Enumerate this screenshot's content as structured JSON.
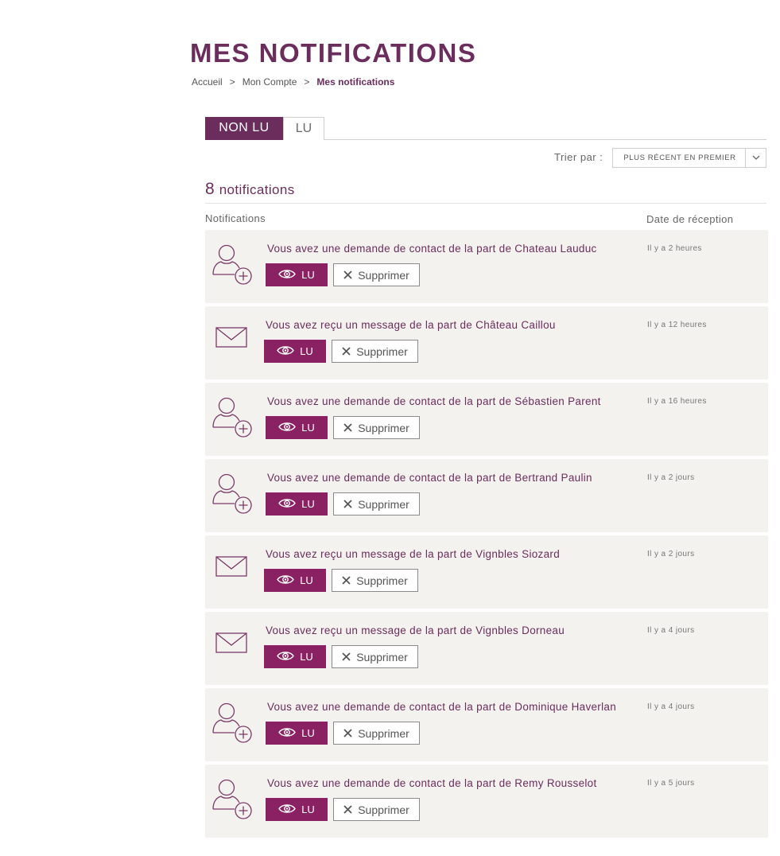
{
  "header": {
    "title": "MES NOTIFICATIONS",
    "breadcrumb": [
      {
        "label": "Accueil"
      },
      {
        "label": "Mon Compte"
      },
      {
        "label": "Mes notifications"
      }
    ],
    "breadcrumb_separator": ">"
  },
  "tabs": [
    {
      "label": "NON LU",
      "active": true
    },
    {
      "label": "LU",
      "active": false
    }
  ],
  "sort": {
    "label": "Trier par :",
    "value": "PLUS RÉCENT EN PREMIER"
  },
  "summary": {
    "count": "8",
    "label": "notifications"
  },
  "columns": {
    "notifications": "Notifications",
    "date": "Date de réception"
  },
  "buttons": {
    "read_label": "LU",
    "delete_label": "Supprimer"
  },
  "colors": {
    "brand": "#6b2d5c",
    "button": "#8a2163",
    "row_bg": "#f4f2ef"
  },
  "notifications": [
    {
      "type": "contact",
      "icon": "user-add-icon",
      "text": "Vous avez une demande de contact de la part de Chateau Lauduc",
      "date": "Il y a 2 heures"
    },
    {
      "type": "message",
      "icon": "envelope-icon",
      "text": "Vous avez reçu un message de la part de Château Caillou",
      "date": "Il y a 12 heures"
    },
    {
      "type": "contact",
      "icon": "user-add-icon",
      "text": "Vous avez une demande de contact de la part de Sébastien Parent",
      "date": "Il y a 16 heures"
    },
    {
      "type": "contact",
      "icon": "user-add-icon",
      "text": "Vous avez une demande de contact de la part de Bertrand Paulin",
      "date": "Il y a 2 jours"
    },
    {
      "type": "message",
      "icon": "envelope-icon",
      "text": "Vous avez reçu un message de la part de Vignbles Siozard",
      "date": "Il y a 2 jours"
    },
    {
      "type": "message",
      "icon": "envelope-icon",
      "text": "Vous avez reçu un message de la part de Vignbles Dorneau",
      "date": "Il y a 4 jours"
    },
    {
      "type": "contact",
      "icon": "user-add-icon",
      "text": "Vous avez une demande de contact de la part de Dominique Haverlan",
      "date": "Il y a 4 jours"
    },
    {
      "type": "contact",
      "icon": "user-add-icon",
      "text": "Vous avez une demande de contact de la part de Remy Rousselot",
      "date": "Il y a 5 jours"
    }
  ]
}
